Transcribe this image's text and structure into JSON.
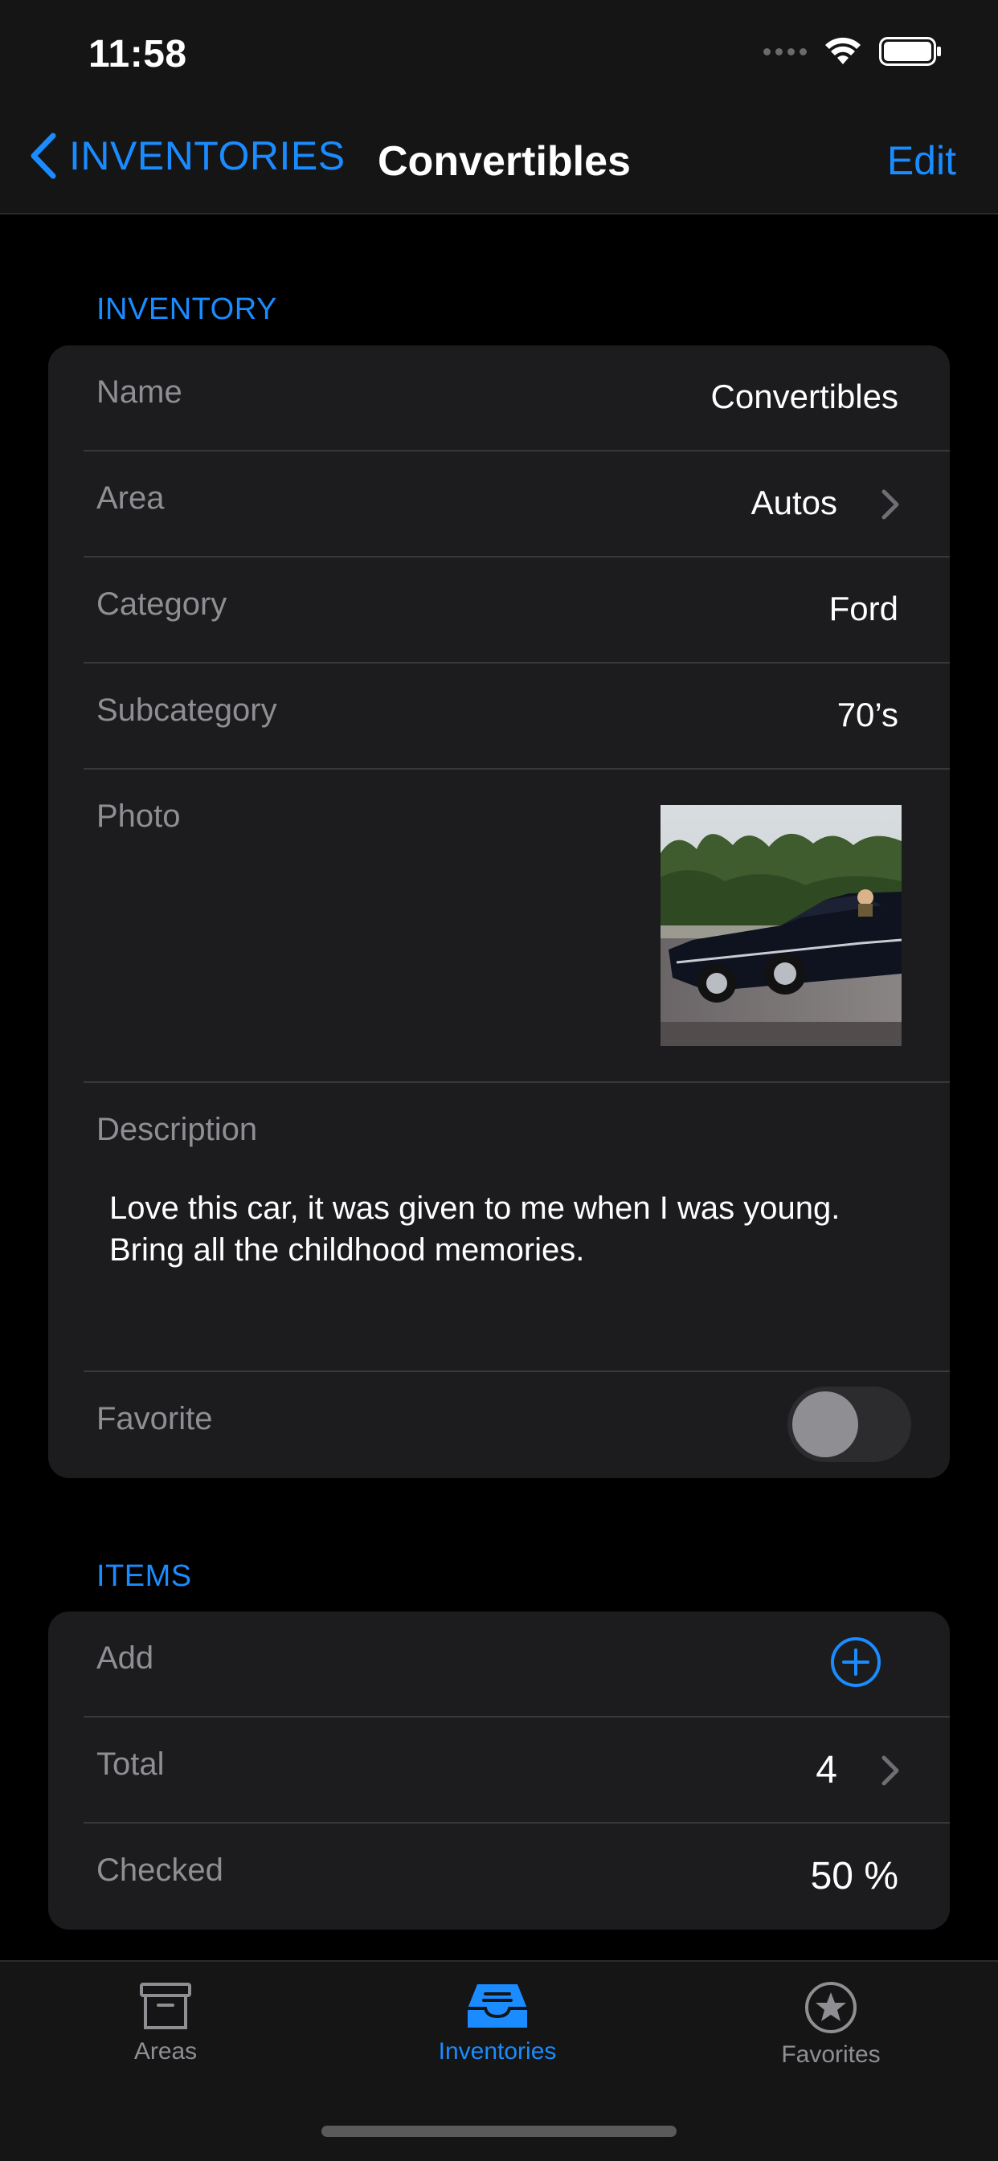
{
  "status_bar": {
    "time": "11:58"
  },
  "nav": {
    "back_label": "INVENTORIES",
    "title": "Convertibles",
    "edit_label": "Edit"
  },
  "inventory_section": {
    "header": "INVENTORY",
    "name_label": "Name",
    "name_value": "Convertibles",
    "area_label": "Area",
    "area_value": "Autos",
    "category_label": "Category",
    "category_value": "Ford",
    "subcategory_label": "Subcategory",
    "subcategory_value": "70’s",
    "photo_label": "Photo",
    "description_label": "Description",
    "description_value": "Love this car, it was given to me when I was young. Bring all the childhood memories.",
    "favorite_label": "Favorite",
    "favorite_on": false
  },
  "items_section": {
    "header": "ITEMS",
    "add_label": "Add",
    "total_label": "Total",
    "total_value": "4",
    "checked_label": "Checked",
    "checked_value": "50 %"
  },
  "tab_bar": {
    "tabs": [
      {
        "label": "Areas",
        "icon": "archive-box-icon",
        "selected": false
      },
      {
        "label": "Inventories",
        "icon": "tray-icon",
        "selected": true
      },
      {
        "label": "Favorites",
        "icon": "star-circle-icon",
        "selected": false
      }
    ]
  },
  "colors": {
    "accent": "#1a8cff",
    "background": "#000000",
    "card": "#1c1c1e",
    "secondary_text": "#8e8e93"
  }
}
